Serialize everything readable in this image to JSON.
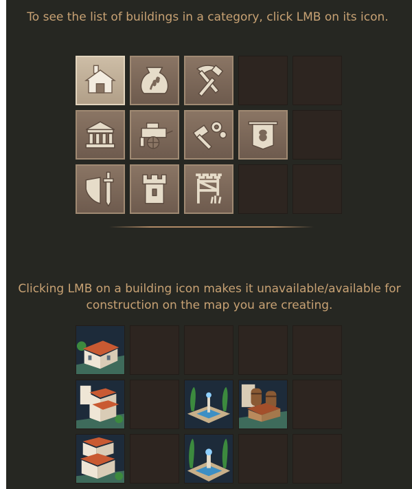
{
  "instructions": {
    "top": "To see the list of buildings in a category, click LMB on its icon.",
    "middle_line1": "Clicking LMB on a building icon makes it unavailable/available for",
    "middle_line2": "construction on the map you are creating."
  },
  "categories": [
    {
      "icon": "house-icon",
      "selected": true
    },
    {
      "icon": "grain-sack-icon",
      "selected": false
    },
    {
      "icon": "pickaxe-hammer-icon",
      "selected": false
    },
    {
      "icon": "public-building-icon",
      "selected": false
    },
    {
      "icon": "cart-icon",
      "selected": false
    },
    {
      "icon": "hammer-gears-icon",
      "selected": false
    },
    {
      "icon": "banner-icon",
      "selected": false
    },
    {
      "icon": "shield-sword-icon",
      "selected": false
    },
    {
      "icon": "tower-icon",
      "selected": false
    },
    {
      "icon": "scaffold-icon",
      "selected": false
    }
  ],
  "buildings": [
    {
      "icon": "villa-icon"
    },
    {
      "icon": "large-villa-icon"
    },
    {
      "icon": "fountain-garden-icon"
    },
    {
      "icon": "barrel-warehouse-icon"
    },
    {
      "icon": "manor-complex-icon"
    },
    {
      "icon": "plaza-fountain-icon"
    }
  ],
  "colors": {
    "panel_bg": "#262722",
    "text": "#c8a274",
    "tile_empty": "#2d2520",
    "tile_category": "#7b6859",
    "tile_selected": "#c2b29b"
  }
}
